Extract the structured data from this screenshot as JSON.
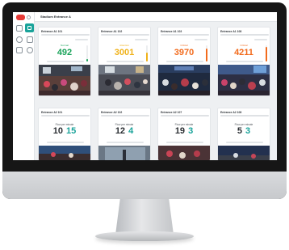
{
  "app": {
    "title": "Stadium Entrance A"
  },
  "entrances_top": [
    {
      "name": "Entrance A1 101",
      "status": "Normal",
      "count": "492",
      "color": "#1aa35a",
      "fill_fraction": 0.15
    },
    {
      "name": "Entrance A1 102",
      "status": "Attention",
      "count": "3001",
      "color": "#f0b21a",
      "fill_fraction": 0.55
    },
    {
      "name": "Entrance A1 103",
      "status": "Critical",
      "count": "3970",
      "color": "#f26b1d",
      "fill_fraction": 0.8
    },
    {
      "name": "Entrance A1 108",
      "status": "Critical",
      "count": "4211",
      "color": "#f26b1d",
      "fill_fraction": 0.9
    }
  ],
  "entrances_bottom": [
    {
      "name": "Entrance A2 101",
      "label": "Flow per minute",
      "in": "10",
      "out": "15"
    },
    {
      "name": "Entrance A2 102",
      "label": "Flow per minute",
      "in": "12",
      "out": "4"
    },
    {
      "name": "Entrance A2 107",
      "label": "Flow per minute",
      "in": "19",
      "out": "3"
    },
    {
      "name": "Entrance A2 108",
      "label": "Flow per minute",
      "in": "5",
      "out": "3"
    }
  ],
  "icons": {
    "brand": "logo-icon",
    "nav": [
      "home-icon",
      "dashboard-icon",
      "search-icon",
      "grid-icon",
      "link-icon",
      "settings-icon"
    ]
  }
}
